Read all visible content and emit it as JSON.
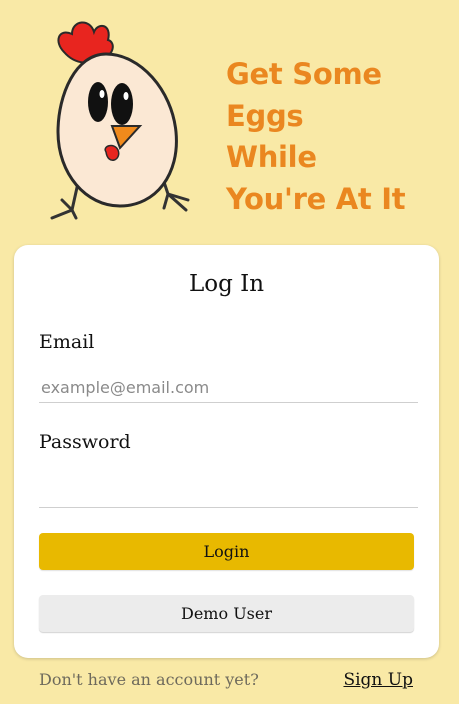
{
  "hero": {
    "mascot_icon": "chicken-egg-mascot",
    "tagline_lines": [
      "Get Some",
      "Eggs",
      "While",
      "You're At It"
    ],
    "tagline_color": "#ea8720"
  },
  "login_card": {
    "title": "Log In",
    "email": {
      "label": "Email",
      "placeholder": "example@email.com",
      "value": ""
    },
    "password": {
      "label": "Password",
      "placeholder": "",
      "value": ""
    },
    "login_button": "Login",
    "demo_button": "Demo User"
  },
  "footer": {
    "prompt": "Don't have an account yet?",
    "signup_link": "Sign Up"
  },
  "colors": {
    "background": "#f9e9a6",
    "login_button": "#e8b900",
    "demo_button": "#ececec"
  }
}
